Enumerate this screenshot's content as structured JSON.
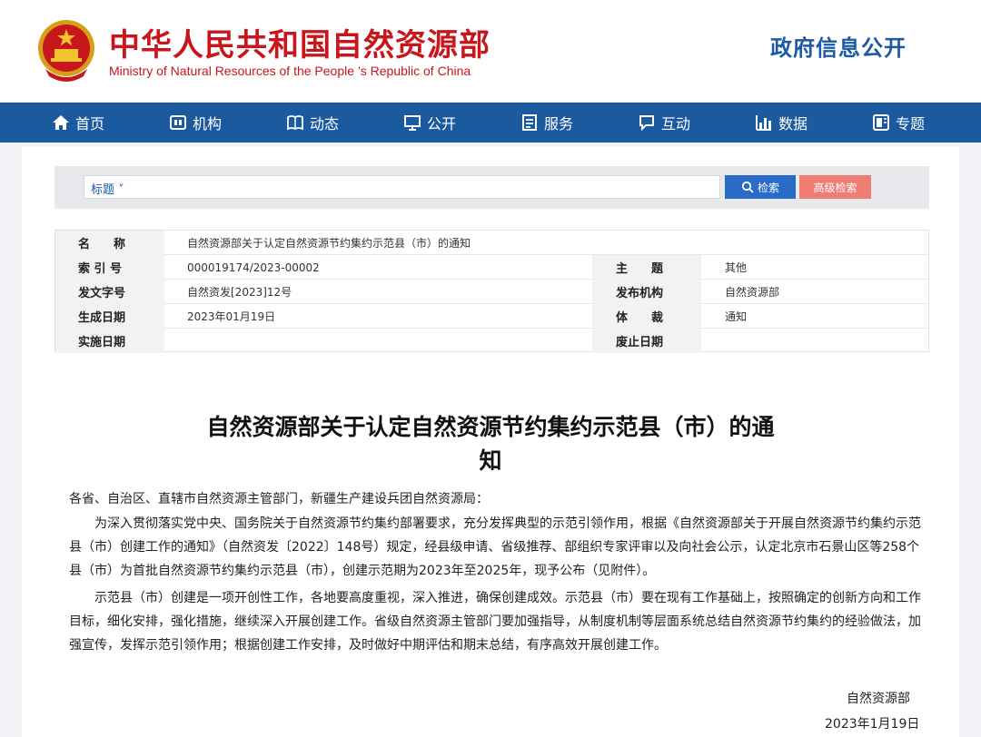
{
  "header": {
    "title_cn": "中华人民共和国自然资源部",
    "title_en": "Ministry of Natural Resources of the People ’s Republic of China",
    "right_title": "政府信息公开"
  },
  "nav": {
    "items": [
      {
        "label": "首页",
        "icon": "home-icon"
      },
      {
        "label": "机构",
        "icon": "institution-icon"
      },
      {
        "label": "动态",
        "icon": "news-icon"
      },
      {
        "label": "公开",
        "icon": "disclosure-icon"
      },
      {
        "label": "服务",
        "icon": "service-icon"
      },
      {
        "label": "互动",
        "icon": "interaction-icon"
      },
      {
        "label": "数据",
        "icon": "chart-icon"
      },
      {
        "label": "专题",
        "icon": "topic-icon"
      }
    ]
  },
  "search": {
    "type_label": "标题 ˅",
    "search_label": "检索",
    "advanced_label": "高级检索"
  },
  "meta": {
    "name_label": "名　　称",
    "name_value": "自然资源部关于认定自然资源节约集约示范县（市）的通知",
    "index_label": "索 引 号",
    "index_value": "000019174/2023-00002",
    "subject_label": "主　　题",
    "subject_value": "其他",
    "docno_label": "发文字号",
    "docno_value": "自然资发[2023]12号",
    "issuer_label": "发布机构",
    "issuer_value": "自然资源部",
    "date_label": "生成日期",
    "date_value": "2023年01月19日",
    "genre_label": "体　　裁",
    "genre_value": "通知",
    "effective_label": "实施日期",
    "effective_value": "",
    "expiry_label": "废止日期",
    "expiry_value": ""
  },
  "document": {
    "title_line1": "自然资源部关于认定自然资源节约集约示范县（市）的通",
    "title_line2": "知",
    "salutation": "各省、自治区、直辖市自然资源主管部门，新疆生产建设兵团自然资源局：",
    "p1_l1": "　　为深入贯彻落实党中央、国务院关于自然资源节约集约部署要求，充分发挥典型的示范引领作用，根据《自然资源部关于开展自然资源节约集约示范",
    "p1_l2": "县（市）创建工作的通知》（自然资发〔2022〕148号）规定，经县级申请、省级推荐、部组织专家评审以及向社会公示，认定北京市石景山区等258个",
    "p1_l3": "县（市）为首批自然资源节约集约示范县（市），创建示范期为2023年至2025年，现予公布（见附件）。",
    "p2_l1": "　　示范县（市）创建是一项开创性工作，各地要高度重视，深入推进，确保创建成效。示范县（市）要在现有工作基础上，按照确定的创新方向和工作",
    "p2_l2": "目标，细化安排，强化措施，继续深入开展创建工作。省级自然资源主管部门要加强指导，从制度机制等层面系统总结自然资源节约集约的经验做法，加",
    "p2_l3": "强宣传，发挥示范引领作用；根据创建工作安排，及时做好中期评估和期末总结，有序高效开展创建工作。",
    "signature": "自然资源部",
    "sign_date": "2023年1月19日"
  }
}
